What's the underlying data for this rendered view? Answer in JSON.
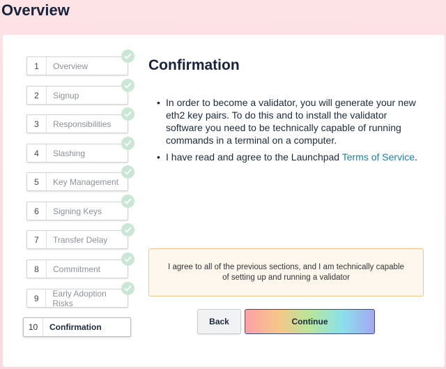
{
  "header": {
    "title": "Overview"
  },
  "steps": [
    {
      "num": "1",
      "label": "Overview"
    },
    {
      "num": "2",
      "label": "Signup"
    },
    {
      "num": "3",
      "label": "Responsibilities"
    },
    {
      "num": "4",
      "label": "Slashing"
    },
    {
      "num": "5",
      "label": "Key Management"
    },
    {
      "num": "6",
      "label": "Signing Keys"
    },
    {
      "num": "7",
      "label": "Transfer Delay"
    },
    {
      "num": "8",
      "label": "Commitment"
    },
    {
      "num": "9",
      "label": "Early Adoption Risks"
    },
    {
      "num": "10",
      "label": "Confirmation"
    }
  ],
  "content": {
    "heading": "Confirmation",
    "bullet1": "In order to become a validator, you will generate your new eth2 key pairs. To do this and to install the validator software you need to be technically capable of running commands in a terminal on a computer.",
    "bullet2_prefix": "I have read and agree to the Launchpad ",
    "bullet2_link": "Terms of Service",
    "bullet2_suffix": ".",
    "agree_text": "I agree to all of the previous sections, and I am technically capable of setting up and running a validator"
  },
  "buttons": {
    "back": "Back",
    "continue": "Continue"
  },
  "colors": {
    "check": "#c9e7d2",
    "link": "#1e7fa8",
    "agree_border": "#f0c48e"
  }
}
